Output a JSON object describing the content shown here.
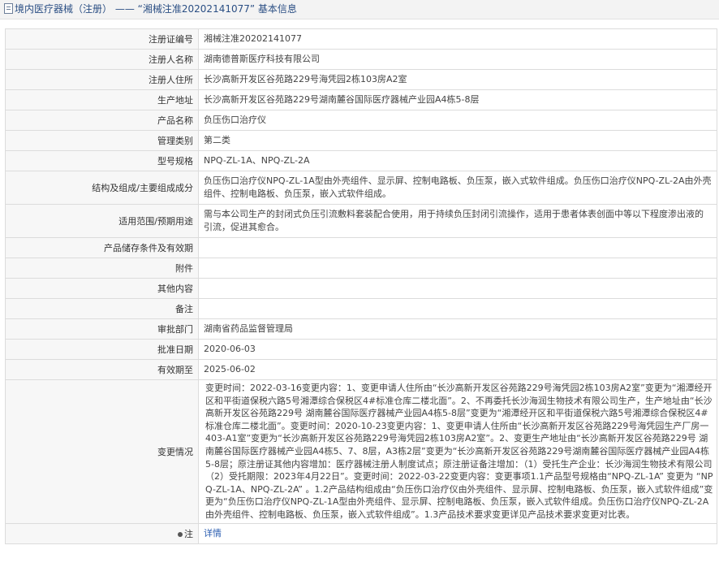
{
  "breadcrumb": {
    "category": "境内医疗器械（注册）",
    "separator": "——",
    "record": "“湘械注准20202141077”",
    "section": "基本信息"
  },
  "fields": {
    "reg_no": {
      "label": "注册证编号",
      "value": "湘械注准20202141077"
    },
    "registrant": {
      "label": "注册人名称",
      "value": "湖南德普斯医疗科技有限公司"
    },
    "address": {
      "label": "注册人住所",
      "value": "长沙高新开发区谷苑路229号海凭园2栋103房A2室"
    },
    "prod_addr": {
      "label": "生产地址",
      "value": "长沙高新开发区谷苑路229号湖南麓谷国际医疗器械产业园A4栋5-8层"
    },
    "product": {
      "label": "产品名称",
      "value": "负压伤口治疗仪"
    },
    "category": {
      "label": "管理类别",
      "value": "第二类"
    },
    "model": {
      "label": "型号规格",
      "value": "NPQ-ZL-1A、NPQ-ZL-2A"
    },
    "structure": {
      "label": "结构及组成/主要组成成分",
      "value": "负压伤口治疗仪NPQ-ZL-1A型由外壳组件、显示屏、控制电路板、负压泵，嵌入式软件组成。负压伤口治疗仪NPQ-ZL-2A由外壳组件、控制电路板、负压泵，嵌入式软件组成。"
    },
    "scope": {
      "label": "适用范围/预期用途",
      "value": "需与本公司生产的封闭式负压引流敷料套装配合使用，用于持续负压封闭引流操作，适用于患者体表创面中等以下程度渗出液的引流，促进其愈合。"
    },
    "storage": {
      "label": "产品储存条件及有效期",
      "value": ""
    },
    "attachment": {
      "label": "附件",
      "value": ""
    },
    "other": {
      "label": "其他内容",
      "value": ""
    },
    "remark": {
      "label": "备注",
      "value": ""
    },
    "dept": {
      "label": "审批部门",
      "value": "湖南省药品监督管理局"
    },
    "approve": {
      "label": "批准日期",
      "value": "2020-06-03"
    },
    "expire": {
      "label": "有效期至",
      "value": "2025-06-02"
    },
    "changes": {
      "label": "变更情况",
      "value": "变更时间：2022-03-16变更内容：1、变更申请人住所由“长沙高新开发区谷苑路229号海凭园2栋103房A2室”变更为“湘潭经开区和平街道保税六路5号湘潭综合保税区4#标准仓库二楼北面”。2、不再委托长沙海润生物技术有限公司生产，生产地址由“长沙高新开发区谷苑路229号 湖南麓谷国际医疗器械产业园A4栋5-8层”变更为“湘潭经开区和平街道保税六路5号湘潭综合保税区4#标准仓库二楼北面”。变更时间：2020-10-23变更内容：1、变更申请人住所由“长沙高新开发区谷苑路229号海凭园生产厂房一403-A1室”变更为“长沙高新开发区谷苑路229号海凭园2栋103房A2室”。2、变更生产地址由“长沙高新开发区谷苑路229号 湖南麓谷国际医疗器械产业园A4栋5、7、8层，A3栋2层”变更为“长沙高新开发区谷苑路229号湖南麓谷国际医疗器械产业园A4栋5-8层；原注册证其他内容增加：医疗器械注册人制度试点；原注册证备注增加：（1）受托生产企业：长沙海润生物技术有限公司（2）受托期限：2023年4月22日”。变更时间：2022-03-22变更内容：变更事项1.1产品型号规格由“NPQ-ZL-1A” 变更为 “NPQ-ZL-1A、NPQ-ZL-2A” 。1.2产品结构组成由“负压伤口治疗仪由外壳组件、显示屏、控制电路板、负压泵，嵌入式软件组成”变更为“负压伤口治疗仪NPQ-ZL-1A型由外壳组件、显示屏、控制电路板、负压泵，嵌入式软件组成。负压伤口治疗仪NPQ-ZL-2A由外壳组件、控制电路板、负压泵，嵌入式软件组成”。1.3产品技术要求变更详见产品技术要求变更对比表。"
    },
    "note": {
      "label": "注",
      "value": "详情"
    }
  }
}
